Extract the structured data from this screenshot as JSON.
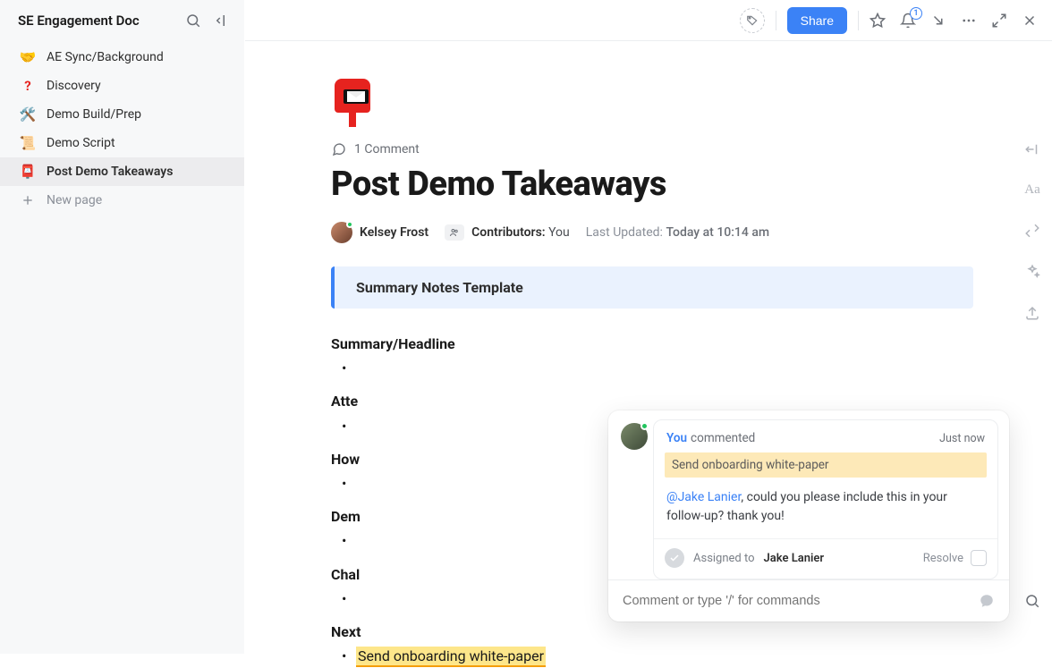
{
  "sidebar": {
    "title": "SE Engagement Doc",
    "items": [
      {
        "emoji": "🤝",
        "label": "AE Sync/Background"
      },
      {
        "emoji": "❓",
        "label": "Discovery"
      },
      {
        "emoji": "🛠️",
        "label": "Demo Build/Prep"
      },
      {
        "emoji": "📜",
        "label": "Demo Script"
      },
      {
        "emoji": "📮",
        "label": "Post Demo Takeaways"
      }
    ],
    "new_page": "New page"
  },
  "topbar": {
    "share": "Share",
    "notif_count": "1"
  },
  "page": {
    "comment_count": "1 Comment",
    "title": "Post Demo Takeaways",
    "owner": "Kelsey Frost",
    "contributors_label": "Contributors:",
    "contributors_value": "You",
    "last_updated_label": "Last Updated:",
    "last_updated_value": "Today at 10:14 am",
    "callout": "Summary Notes Template",
    "sections": {
      "s1": "Summary/Headline",
      "s2": "Atte",
      "s3": "How",
      "s4": "Dem",
      "s5": "Chal",
      "s6": "Next",
      "next_bullet": "Send onboarding white-paper"
    }
  },
  "comment": {
    "you": "You",
    "action": "commented",
    "time": "Just now",
    "quoted": "Send onboarding white-paper",
    "mention": "@Jake Lanier",
    "body": ", could you please include this in your follow-up? thank you!",
    "assigned_to_label": "Assigned to",
    "assignee": "Jake Lanier",
    "resolve": "Resolve",
    "reply_placeholder": "Comment or type '/' for commands"
  }
}
